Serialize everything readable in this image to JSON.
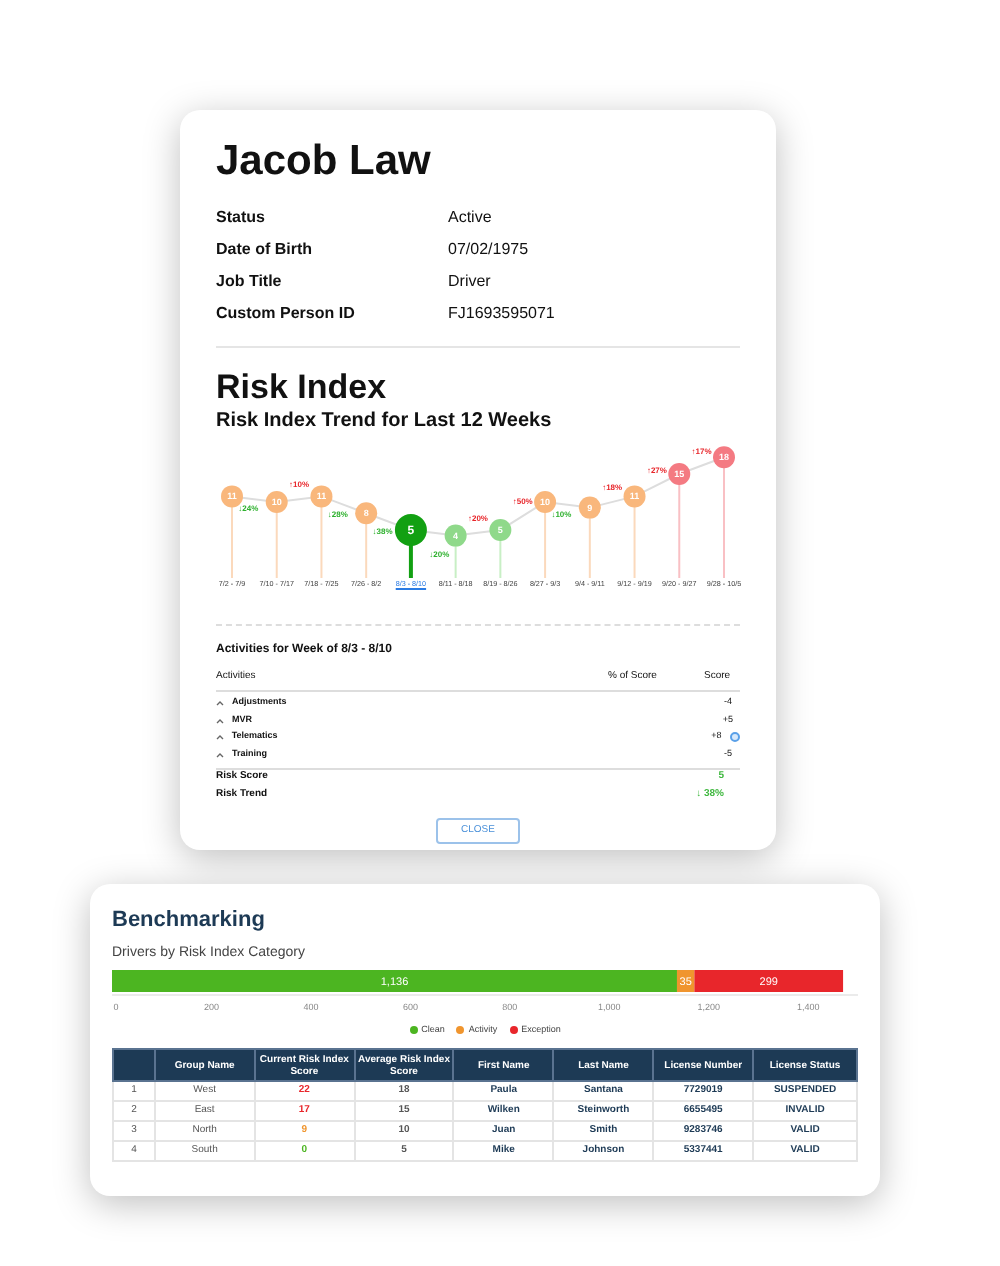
{
  "person": {
    "name": "Jacob Law",
    "fields": [
      {
        "label": "Status",
        "value": "Active"
      },
      {
        "label": "Date of Birth",
        "value": "07/02/1975"
      },
      {
        "label": "Job Title",
        "value": "Driver"
      },
      {
        "label": "Custom Person ID",
        "value": "FJ1693595071"
      }
    ]
  },
  "risk_index": {
    "title": "Risk Index",
    "subtitle": "Risk Index Trend for Last 12 Weeks",
    "weeks": [
      {
        "label": "7/2 - 7/9",
        "selected": false
      },
      {
        "label": "7/10 - 7/17",
        "selected": false
      },
      {
        "label": "7/18 - 7/25",
        "selected": false
      },
      {
        "label": "7/26 - 8/2",
        "selected": false
      },
      {
        "label": "8/3 - 8/10",
        "selected": true
      },
      {
        "label": "8/11 - 8/18",
        "selected": false
      },
      {
        "label": "8/19 - 8/26",
        "selected": false
      },
      {
        "label": "8/27 - 9/3",
        "selected": false
      },
      {
        "label": "9/4 - 9/11",
        "selected": false
      },
      {
        "label": "9/12 - 9/19",
        "selected": false
      },
      {
        "label": "9/20 - 9/27",
        "selected": false
      },
      {
        "label": "9/28 - 10/5",
        "selected": false
      }
    ],
    "chart_data": {
      "type": "line",
      "data_labels": true,
      "grid": "x",
      "series": [
        {
          "color": "#dddddd",
          "marker": "circle",
          "values": [
            11,
            10,
            11,
            8,
            5,
            4,
            5,
            10,
            9,
            11,
            15,
            18
          ]
        }
      ],
      "annotations": [
        "↓24%",
        "↑10%",
        "↓28%",
        "↓38%",
        "↓20%",
        "↑20%",
        "↑50%",
        "↓10%",
        "↑18%",
        "↑27%",
        "↑17%"
      ]
    }
  },
  "activities": {
    "title": "Activities for Week of 8/3 - 8/10",
    "columns": [
      "Activities",
      "% of Score",
      "Score"
    ],
    "rows": [
      {
        "name": "Adjustments",
        "score": "-4",
        "info": false
      },
      {
        "name": "MVR",
        "score": "+5",
        "info": false
      },
      {
        "name": "Telematics",
        "score": "+8",
        "info": true
      },
      {
        "name": "Training",
        "score": "-5",
        "info": false
      }
    ],
    "summary": [
      {
        "label": "Risk Score",
        "value": "5"
      },
      {
        "label": "Risk Trend",
        "value": "↓ 38%"
      }
    ],
    "close_button": "CLOSE"
  },
  "benchmarking": {
    "title": "Benchmarking",
    "subtitle": "Drivers by Risk Index Category",
    "chart_data": {
      "type": "bar",
      "orientation": "horizontal",
      "stacked": true,
      "legend": "bottom",
      "series": [
        {
          "name": "Clean",
          "color": "#4cb521",
          "values": [
            1136
          ],
          "value_labels": [
            "1,136"
          ]
        },
        {
          "name": "Activity",
          "color": "#f0952e",
          "values": [
            35
          ],
          "value_labels": [
            "35"
          ]
        },
        {
          "name": "Exception",
          "color": "#e8262b",
          "values": [
            299
          ],
          "value_labels": [
            "299"
          ]
        }
      ],
      "xlim": [
        0,
        1500
      ],
      "xticks": [
        0,
        200,
        400,
        600,
        800,
        {
          "value": 1000,
          "label": "1,000"
        },
        {
          "value": 1200,
          "label": "1,200"
        },
        {
          "value": 1400,
          "label": "1,400"
        }
      ]
    },
    "table": {
      "columns": [
        "",
        "Group Name",
        "Current Risk Index Score",
        "Average Risk Index Score",
        "First Name",
        "Last Name",
        "License Number",
        "License Status"
      ],
      "rows": [
        {
          "cells": [
            "1",
            "West",
            "22",
            "18",
            "Paula",
            "Santana",
            "7729019",
            "SUSPENDED"
          ],
          "color": "#e8262b"
        },
        {
          "cells": [
            "2",
            "East",
            "17",
            "15",
            "Wilken",
            "Steinworth",
            "6655495",
            "INVALID"
          ],
          "color": "#e8262b"
        },
        {
          "cells": [
            "3",
            "North",
            "9",
            "10",
            "Juan",
            "Smith",
            "9283746",
            "VALID"
          ],
          "color": "#f0952e"
        },
        {
          "cells": [
            "4",
            "South",
            "0",
            "5",
            "Mike",
            "Johnson",
            "5337441",
            "VALID"
          ],
          "color": "#4cb521"
        }
      ]
    }
  }
}
